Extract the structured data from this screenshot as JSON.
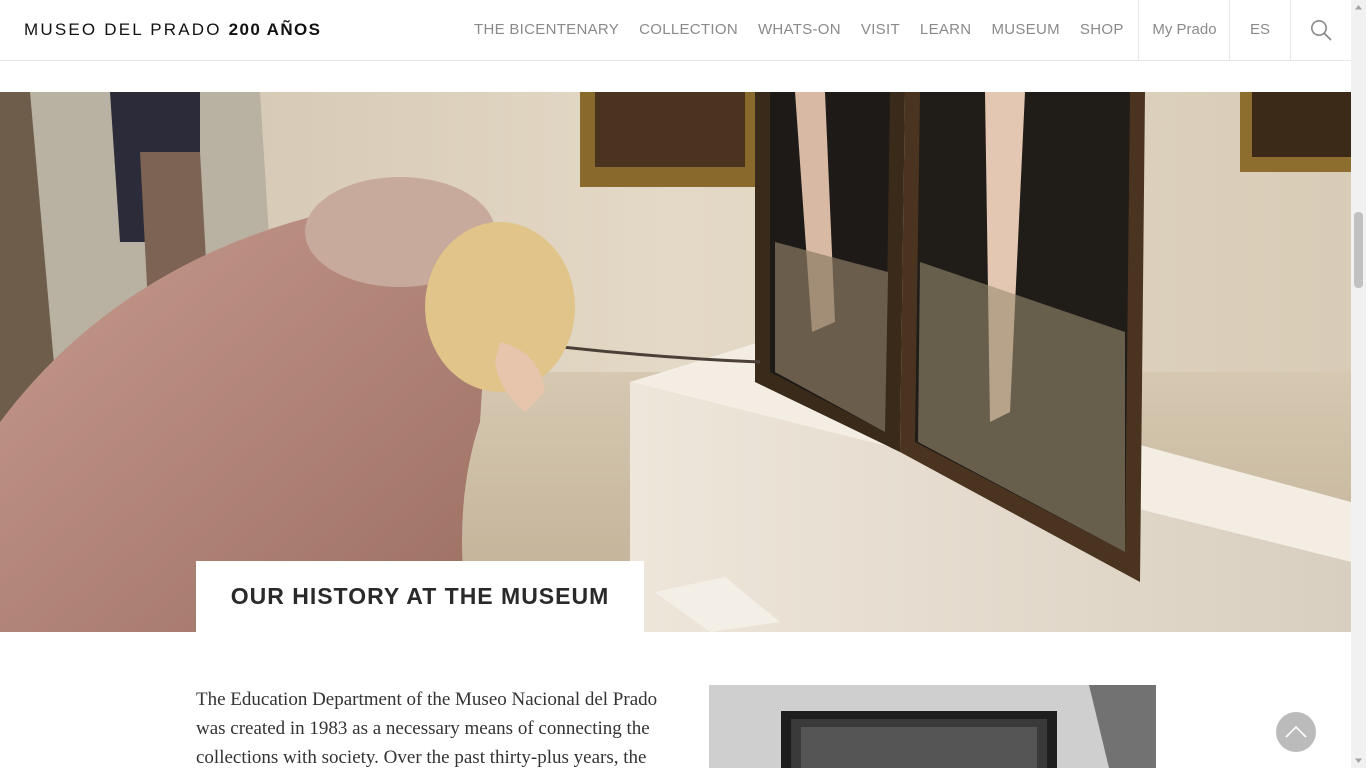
{
  "header": {
    "logo_text": "MUSEO DEL PRADO",
    "logo_bold": "200 AÑOS",
    "nav": [
      {
        "label": "THE BICENTENARY"
      },
      {
        "label": "COLLECTION"
      },
      {
        "label": "WHATS-ON"
      },
      {
        "label": "VISIT"
      },
      {
        "label": "LEARN"
      },
      {
        "label": "MUSEUM"
      },
      {
        "label": "SHOP"
      }
    ],
    "my_prado": "My Prado",
    "language": "ES",
    "search_icon": "search-icon"
  },
  "hero": {
    "title": "OUR HISTORY AT THE MUSEUM"
  },
  "content": {
    "intro": "The Education Department of the Museo Nacional del Prado was created in 1983 as a necessary means of connecting the collections with society. Over the past thirty-plus years, the department has"
  },
  "colors": {
    "nav_text": "#8a8a8a",
    "border": "#e6e6e6",
    "back_to_top": "#969696"
  },
  "icons": {
    "back_to_top": "chevron-up-icon"
  }
}
